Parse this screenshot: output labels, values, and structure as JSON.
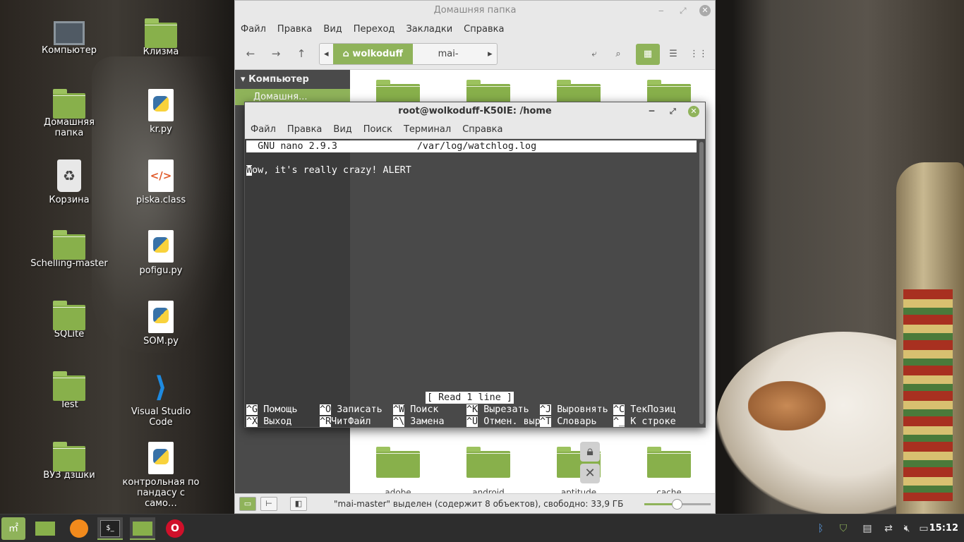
{
  "desktop": {
    "icons": [
      {
        "label": "Компьютер",
        "icon": "computer-icon"
      },
      {
        "label": "Клизма",
        "icon": "folder-icon"
      },
      {
        "label": "Домашняя папка",
        "icon": "home-folder-icon"
      },
      {
        "label": "kr.py",
        "icon": "python-file-icon"
      },
      {
        "label": "Корзина",
        "icon": "trash-icon"
      },
      {
        "label": "piska.class",
        "icon": "code-file-icon"
      },
      {
        "label": "Schelling-master",
        "icon": "folder-icon"
      },
      {
        "label": "pofigu.py",
        "icon": "python-file-icon"
      },
      {
        "label": "SQLite",
        "icon": "folder-icon"
      },
      {
        "label": "SOM.py",
        "icon": "python-file-icon"
      },
      {
        "label": "Test",
        "icon": "folder-icon"
      },
      {
        "label": "Visual Studio Code",
        "icon": "vscode-icon"
      },
      {
        "label": "ВУЗ дзшки",
        "icon": "folder-icon"
      },
      {
        "label": "контрольная по пандасу с само…",
        "icon": "python-file-icon"
      }
    ]
  },
  "file_manager": {
    "title": "Домашняя папка",
    "menu": [
      "Файл",
      "Правка",
      "Вид",
      "Переход",
      "Закладки",
      "Справка"
    ],
    "path": {
      "current": "wolkoduff",
      "next": "mai-master"
    },
    "sidebar": {
      "section": "Компьютер",
      "selected": "Домашня..."
    },
    "bottom_folders": [
      "adobe",
      "android",
      "aptitude",
      "cache"
    ],
    "status": "\"mai-master\" выделен (содержит 8 объектов), свободно: 33,9 ГБ",
    "zoom_fraction": 0.5
  },
  "terminal": {
    "title": "root@wolkoduff-K50IE: /home",
    "menu": [
      "Файл",
      "Правка",
      "Вид",
      "Поиск",
      "Терминал",
      "Справка"
    ],
    "nano": {
      "header": "  GNU nano 2.9.3              /var/log/watchlog.log",
      "first_char": "W",
      "line": "ow, it's really crazy! ALERT",
      "message": "[ Read 1 line ]",
      "shortcuts": [
        {
          "key": "^G",
          "label": "Помощь"
        },
        {
          "key": "^O",
          "label": "Записать"
        },
        {
          "key": "^W",
          "label": "Поиск"
        },
        {
          "key": "^K",
          "label": "Вырезать"
        },
        {
          "key": "^J",
          "label": "Выровнять"
        },
        {
          "key": "^C",
          "label": "ТекПозиц"
        },
        {
          "key": "^X",
          "label": "Выход"
        },
        {
          "key": "^R",
          "label": "ЧитФайл"
        },
        {
          "key": "^\\",
          "label": "Замена"
        },
        {
          "key": "^U",
          "label": "Отмен. выр"
        },
        {
          "key": "^T",
          "label": "Словарь"
        },
        {
          "key": "^_",
          "label": "К строке"
        }
      ]
    }
  },
  "taskbar": {
    "clock": "15:12",
    "apps": [
      "mint-menu-icon",
      "files-icon",
      "firefox-icon",
      "terminal-icon",
      "files-icon",
      "opera-icon"
    ]
  }
}
